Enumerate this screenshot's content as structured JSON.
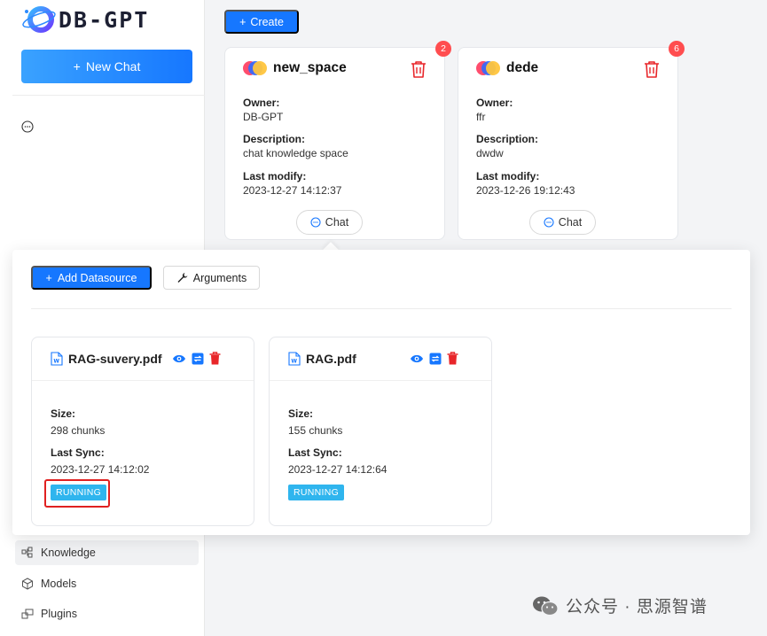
{
  "app": {
    "logo_text": "DB-GPT"
  },
  "sidebar": {
    "new_chat_label": "New Chat",
    "nav": [
      {
        "label": "Knowledge",
        "icon": "knowledge-icon"
      },
      {
        "label": "Models",
        "icon": "models-icon"
      },
      {
        "label": "Plugins",
        "icon": "plugins-icon"
      }
    ]
  },
  "toolbar": {
    "create_label": "Create"
  },
  "spaces": [
    {
      "name": "new_space",
      "badge": "2",
      "owner_label": "Owner:",
      "owner": "DB-GPT",
      "description_label": "Description:",
      "description": "chat knowledge space",
      "last_modify_label": "Last modify:",
      "last_modify": "2023-12-27 14:12:37",
      "chat_label": "Chat"
    },
    {
      "name": "dede",
      "badge": "6",
      "owner_label": "Owner:",
      "owner": "ffr",
      "description_label": "Description:",
      "description": "dwdw",
      "last_modify_label": "Last modify:",
      "last_modify": "2023-12-26 19:12:43",
      "chat_label": "Chat"
    }
  ],
  "panel": {
    "add_datasource_label": "Add Datasource",
    "arguments_label": "Arguments",
    "documents": [
      {
        "name": "RAG-suvery.pdf",
        "size_label": "Size:",
        "size": "298 chunks",
        "last_sync_label": "Last Sync:",
        "last_sync": "2023-12-27 14:12:02",
        "status": "RUNNING"
      },
      {
        "name": "RAG.pdf",
        "size_label": "Size:",
        "size": "155 chunks",
        "last_sync_label": "Last Sync:",
        "last_sync": "2023-12-27 14:12:64",
        "status": "RUNNING"
      }
    ]
  },
  "watermark": "公众号 · 思源智谱",
  "colors": {
    "primary": "#1677ff",
    "danger": "#ff4d4f",
    "status_running": "#2fb5ee"
  }
}
